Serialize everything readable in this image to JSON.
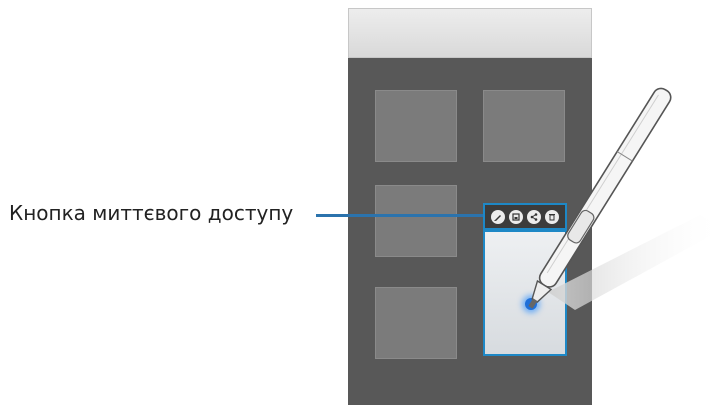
{
  "callout": {
    "label": "Кнопка миттєвого доступу"
  },
  "quick_buttons": [
    {
      "icon": "draw-icon",
      "glyph": "✎"
    },
    {
      "icon": "save-icon",
      "glyph": "◙"
    },
    {
      "icon": "share-icon",
      "glyph": "<"
    },
    {
      "icon": "delete-icon",
      "glyph": "▥"
    }
  ],
  "colors": {
    "accent": "#1e88c6",
    "screen": "#585858",
    "tile": "#7b7b7b",
    "label_line": "#2b73ad",
    "pen_tip_glow": "#1f6fd8"
  }
}
